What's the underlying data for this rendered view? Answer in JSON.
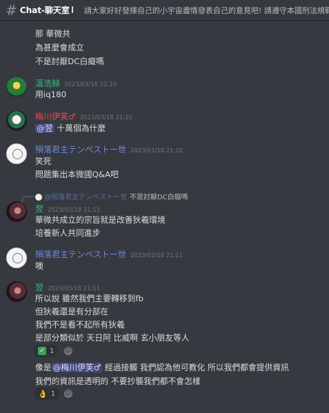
{
  "channel": {
    "name": "Chat-聊天室",
    "topic": "請大家好好發揮自己的小宇宙盡情發表自己的意見吧! 請遵守本國刑法規範"
  },
  "messages": {
    "m0": {
      "lines": [
        "那 華微共",
        "為甚麼會成立",
        "不是討厭DC白癡嗎"
      ]
    },
    "m1": {
      "author": "溫浩赫",
      "author_color": "#43b581",
      "time": "2023/03/18 21:10",
      "lines": [
        "用iq180"
      ]
    },
    "m2": {
      "author": "梅川伊芙♂",
      "author_color": "#f04747",
      "time": "2023/03/18 21:10",
      "mention": "@翌",
      "text": "十萬個為什麼"
    },
    "m3": {
      "author": "殞落君主テンペストー世",
      "author_color": "#7289da",
      "time": "2023/03/18 21:10",
      "lines": [
        "笑死",
        "問題集出本微國Q&A吧"
      ]
    },
    "m4": {
      "reply": {
        "author": "@殞落君主テンペストー世",
        "text": "不是討厭DC白癡嗎"
      },
      "author": "翌",
      "author_color": "#43b581",
      "time": "2023/03/18 21:11",
      "lines": [
        "華微共成立的宗旨就是改善狄羲環境",
        "培養新人共同進步"
      ]
    },
    "m5": {
      "author": "殞落君主テンペストー世",
      "author_color": "#7289da",
      "time": "2023/03/18 21:11",
      "lines": [
        "噢"
      ]
    },
    "m6": {
      "author": "翌",
      "author_color": "#43b581",
      "time": "2023/03/18 21:11",
      "lines": [
        "所以說 雖然我們主要轉移到fb",
        "但狄羲還是有分部在",
        "我們不是看不起所有狄羲",
        "是部分類似於 天日阿 比威啊 玄小朋友等人"
      ],
      "reaction1": {
        "emoji": "✅",
        "count": "1"
      },
      "line5_pre": "像是",
      "mention": "@梅川伊芙♂",
      "line5_post": "經過接觸 我們認為他可教化 所以我們都會提供資訊",
      "line6": "我們的資訊是透明的 不要抄襲我們都不會怎樣",
      "reaction2": {
        "emoji": "👌",
        "count": "1"
      }
    }
  }
}
